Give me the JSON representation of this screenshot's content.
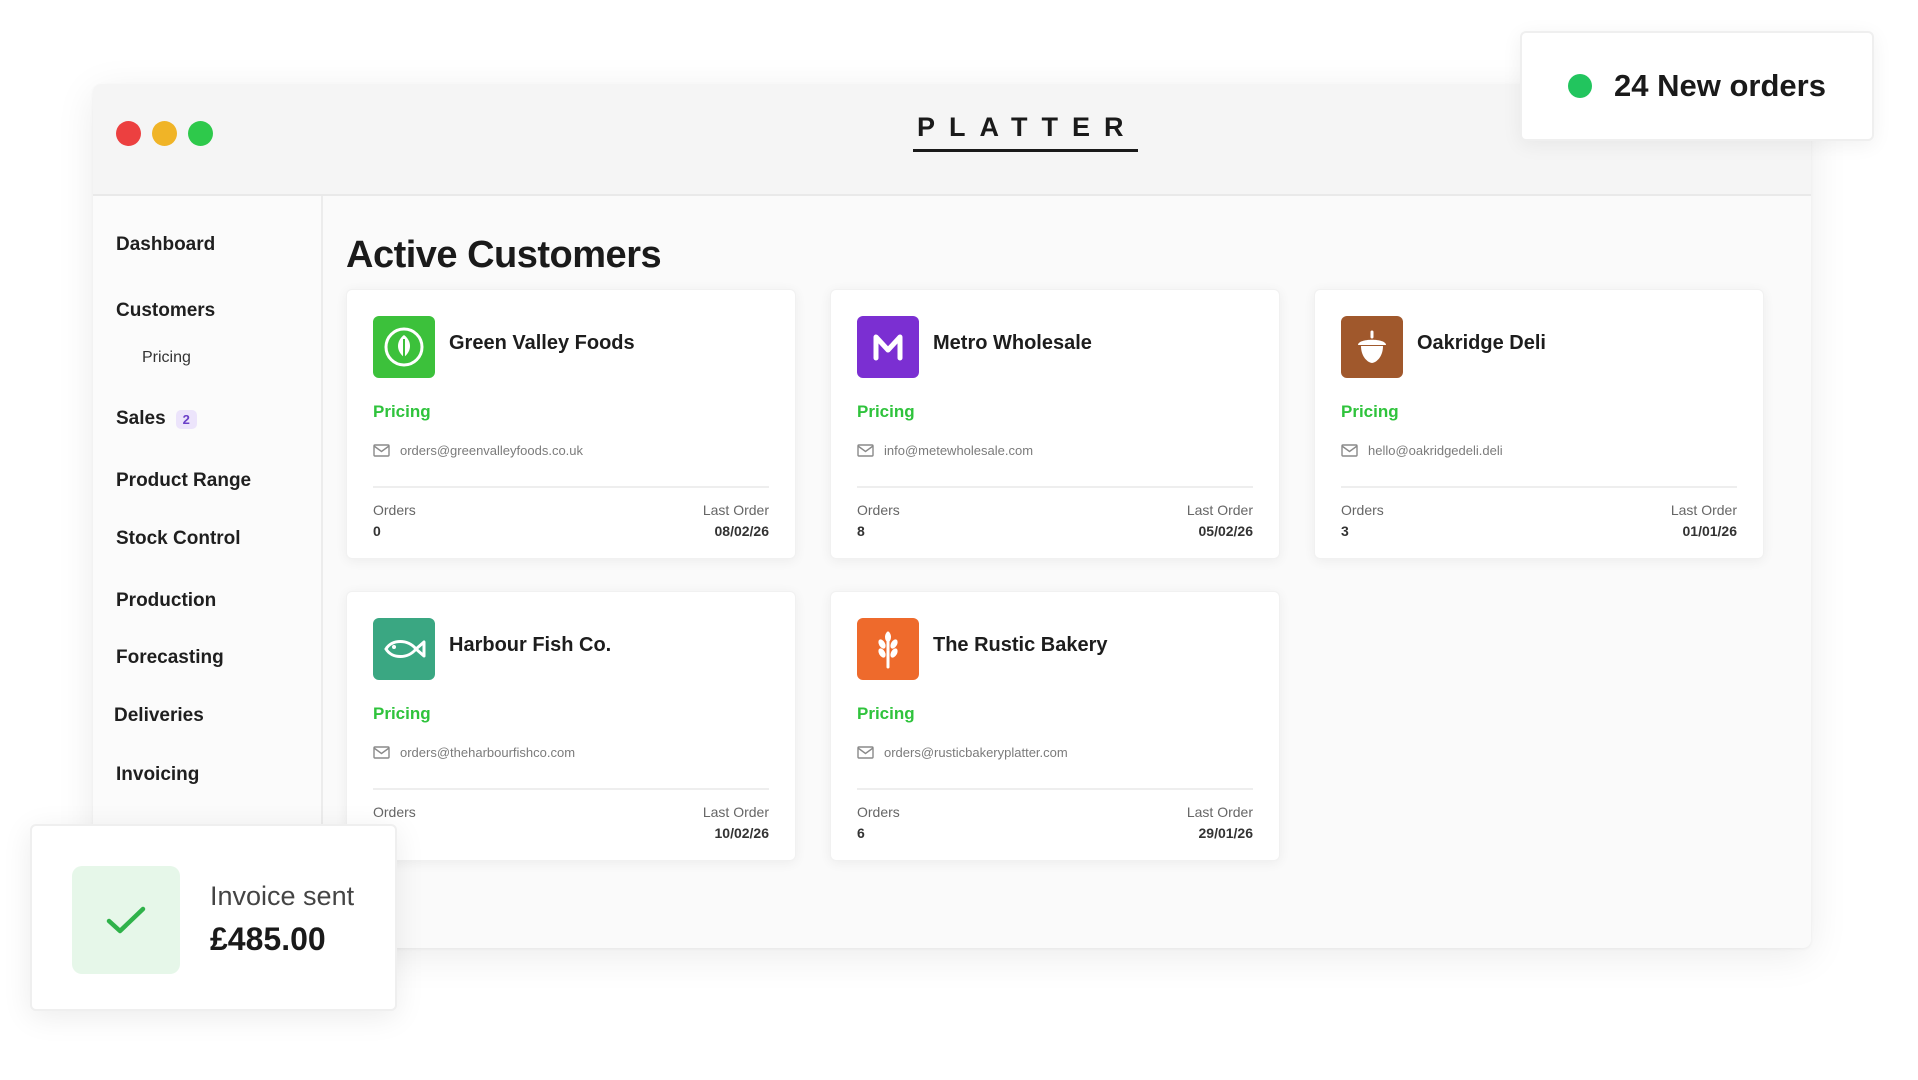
{
  "app": {
    "logo": "PLATTER"
  },
  "sidebar": {
    "items": [
      {
        "label": "Dashboard"
      },
      {
        "label": "Customers"
      },
      {
        "label": "Pricing"
      },
      {
        "label": "Sales",
        "badge": "2"
      },
      {
        "label": "Product Range"
      },
      {
        "label": "Stock Control"
      },
      {
        "label": "Production"
      },
      {
        "label": "Forecasting"
      },
      {
        "label": "Deliveries"
      },
      {
        "label": "Invoicing"
      }
    ]
  },
  "main": {
    "title": "Active Customers",
    "customers": [
      {
        "name": "Green Valley Foods",
        "pricing_label": "Pricing",
        "email": "orders@greenvalleyfoods.co.uk",
        "orders_label": "Orders",
        "orders": "0",
        "last_order_label": "Last Order",
        "last_order": "08/02/26",
        "icon": "leaf-icon",
        "color": "#3cc13b"
      },
      {
        "name": "Metro Wholesale",
        "pricing_label": "Pricing",
        "email": "info@metewholesale.com",
        "orders_label": "Orders",
        "orders": "8",
        "last_order_label": "Last Order",
        "last_order": "05/02/26",
        "icon": "letter-m-icon",
        "color": "#7b2fd2"
      },
      {
        "name": "Oakridge Deli",
        "pricing_label": "Pricing",
        "email": "hello@oakridgedeli.deli",
        "orders_label": "Orders",
        "orders": "3",
        "last_order_label": "Last Order",
        "last_order": "01/01/26",
        "icon": "acorn-icon",
        "color": "#a0582c"
      },
      {
        "name": "Harbour Fish Co.",
        "pricing_label": "Pricing",
        "email": "orders@theharbourfishco.com",
        "orders_label": "Orders",
        "orders": "",
        "last_order_label": "Last Order",
        "last_order": "10/02/26",
        "icon": "fish-icon",
        "color": "#3aa782"
      },
      {
        "name": "The Rustic Bakery",
        "pricing_label": "Pricing",
        "email": "orders@rusticbakeryplatter.com",
        "orders_label": "Orders",
        "orders": "6",
        "last_order_label": "Last Order",
        "last_order": "29/01/26",
        "icon": "wheat-icon",
        "color": "#ee6a2c"
      }
    ]
  },
  "notifications": {
    "orders": {
      "text": "24 New orders",
      "color": "#22c55e"
    },
    "invoice": {
      "title": "Invoice sent",
      "amount": "£485.00",
      "icon": "check-icon"
    }
  }
}
